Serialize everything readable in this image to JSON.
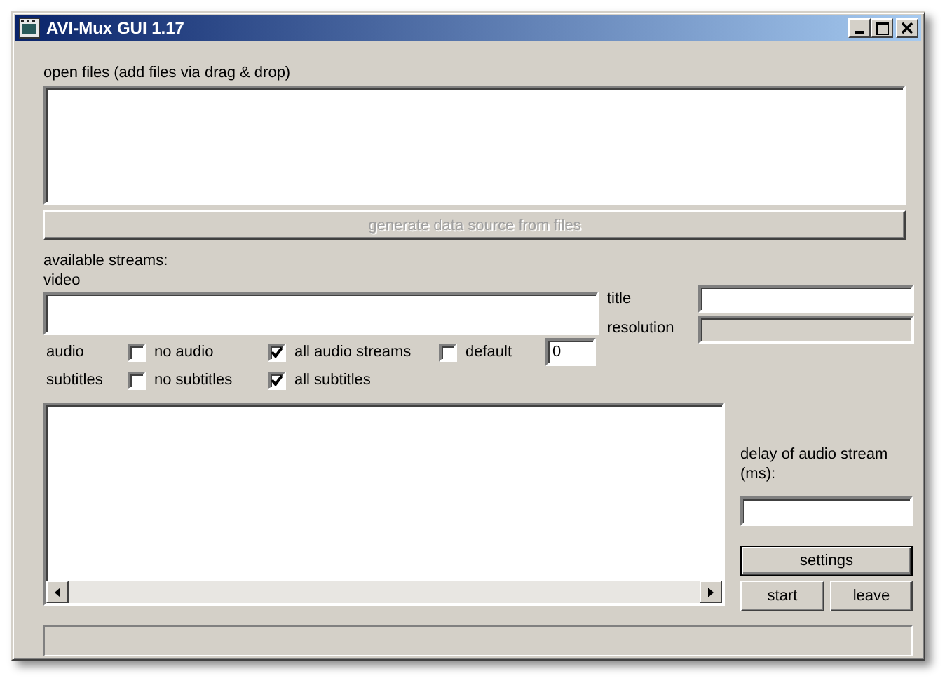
{
  "window": {
    "title": "AVI-Mux GUI 1.17"
  },
  "open_files": {
    "label": "open files (add files via drag & drop)"
  },
  "generate_button": {
    "label": "generate data source from files",
    "disabled": true
  },
  "streams": {
    "label": "available streams:",
    "video_label": "video"
  },
  "title_field": {
    "label": "title"
  },
  "resolution_field": {
    "label": "resolution",
    "disabled": true
  },
  "audio": {
    "label": "audio",
    "number": "0",
    "options": [
      {
        "label": "no audio",
        "checked": false
      },
      {
        "label": "all audio streams",
        "checked": true
      },
      {
        "label": "default",
        "checked": false
      }
    ]
  },
  "subtitles": {
    "label": "subtitles",
    "options": [
      {
        "label": "no subtitles",
        "checked": false
      },
      {
        "label": "all subtitles",
        "checked": true
      }
    ]
  },
  "delay": {
    "label": "delay of audio stream (ms):"
  },
  "buttons": [
    {
      "label": "settings",
      "default": true
    },
    {
      "label": "start",
      "default": false
    },
    {
      "label": "leave",
      "default": false
    }
  ]
}
